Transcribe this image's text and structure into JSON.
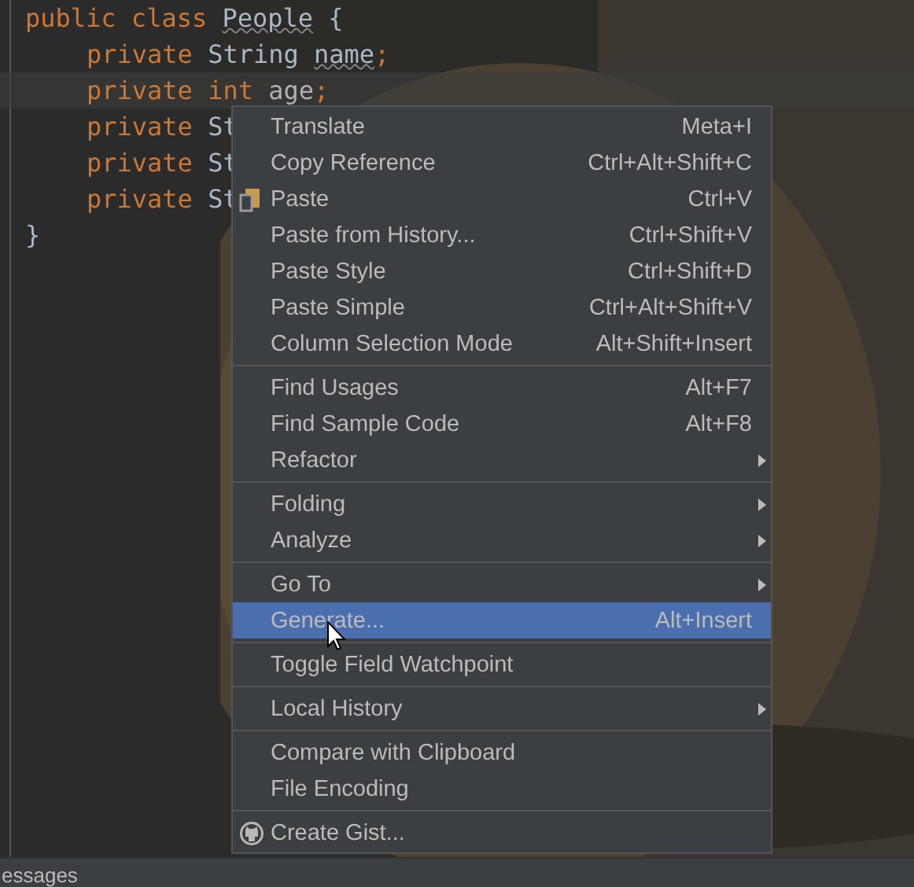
{
  "editor": {
    "lines": [
      {
        "current": false,
        "tokens": [
          {
            "kind": "keyword",
            "text": "public class "
          },
          {
            "kind": "warn",
            "text": "People"
          },
          {
            "kind": "plain",
            "text": " {"
          }
        ]
      },
      {
        "current": false,
        "tokens": [
          {
            "kind": "indent"
          },
          {
            "kind": "keyword",
            "text": "private "
          },
          {
            "kind": "plain",
            "text": "String "
          },
          {
            "kind": "warn",
            "text": "name"
          },
          {
            "kind": "keyword",
            "text": ";"
          }
        ]
      },
      {
        "current": true,
        "tokens": [
          {
            "kind": "indent"
          },
          {
            "kind": "keyword",
            "text": "private int "
          },
          {
            "kind": "unused",
            "text": "age"
          },
          {
            "kind": "keyword",
            "text": ";"
          }
        ]
      },
      {
        "current": false,
        "tokens": [
          {
            "kind": "indent"
          },
          {
            "kind": "keyword",
            "text": "private "
          },
          {
            "kind": "plain",
            "text": "St"
          }
        ]
      },
      {
        "current": false,
        "tokens": [
          {
            "kind": "indent"
          },
          {
            "kind": "keyword",
            "text": "private "
          },
          {
            "kind": "plain",
            "text": "St"
          }
        ]
      },
      {
        "current": false,
        "tokens": [
          {
            "kind": "indent"
          },
          {
            "kind": "keyword",
            "text": "private "
          },
          {
            "kind": "plain",
            "text": "St"
          }
        ]
      },
      {
        "current": false,
        "tokens": [
          {
            "kind": "plain",
            "text": "}"
          }
        ]
      }
    ]
  },
  "context_menu": {
    "items": [
      {
        "kind": "item",
        "label": "Translate",
        "shortcut": "Meta+I",
        "submenu": false,
        "selected": false
      },
      {
        "kind": "item",
        "label": "Copy Reference",
        "shortcut": "Ctrl+Alt+Shift+C",
        "submenu": false,
        "selected": false
      },
      {
        "kind": "clipboard",
        "label": "Paste",
        "shortcut": "Ctrl+V",
        "submenu": false,
        "selected": false
      },
      {
        "kind": "item",
        "label": "Paste from History...",
        "shortcut": "Ctrl+Shift+V",
        "submenu": false,
        "selected": false
      },
      {
        "kind": "item",
        "label": "Paste Style",
        "shortcut": "Ctrl+Shift+D",
        "submenu": false,
        "selected": false
      },
      {
        "kind": "item",
        "label": "Paste Simple",
        "shortcut": "Ctrl+Alt+Shift+V",
        "submenu": false,
        "selected": false
      },
      {
        "kind": "item",
        "label": "Column Selection Mode",
        "shortcut": "Alt+Shift+Insert",
        "submenu": false,
        "selected": false
      },
      {
        "kind": "separator"
      },
      {
        "kind": "item",
        "label": "Find Usages",
        "shortcut": "Alt+F7",
        "submenu": false,
        "selected": false
      },
      {
        "kind": "item",
        "label": "Find Sample Code",
        "shortcut": "Alt+F8",
        "submenu": false,
        "selected": false
      },
      {
        "kind": "item",
        "label": "Refactor",
        "submenu": true,
        "selected": false
      },
      {
        "kind": "separator"
      },
      {
        "kind": "item",
        "label": "Folding",
        "submenu": true,
        "selected": false
      },
      {
        "kind": "item",
        "label": "Analyze",
        "submenu": true,
        "selected": false
      },
      {
        "kind": "separator"
      },
      {
        "kind": "item",
        "label": "Go To",
        "submenu": true,
        "selected": false
      },
      {
        "kind": "item",
        "label": "Generate...",
        "shortcut": "Alt+Insert",
        "submenu": false,
        "selected": true
      },
      {
        "kind": "separator"
      },
      {
        "kind": "item",
        "label": "Toggle Field Watchpoint",
        "submenu": false,
        "selected": false
      },
      {
        "kind": "separator"
      },
      {
        "kind": "item",
        "label": "Local History",
        "submenu": true,
        "selected": false
      },
      {
        "kind": "separator"
      },
      {
        "kind": "item",
        "label": "Compare with Clipboard",
        "submenu": false,
        "selected": false
      },
      {
        "kind": "item",
        "label": "File Encoding",
        "submenu": false,
        "selected": false
      },
      {
        "kind": "separator"
      },
      {
        "kind": "gist",
        "label": "Create Gist...",
        "submenu": false,
        "selected": false
      }
    ]
  },
  "bottom_bar": {
    "tab": "essages"
  }
}
